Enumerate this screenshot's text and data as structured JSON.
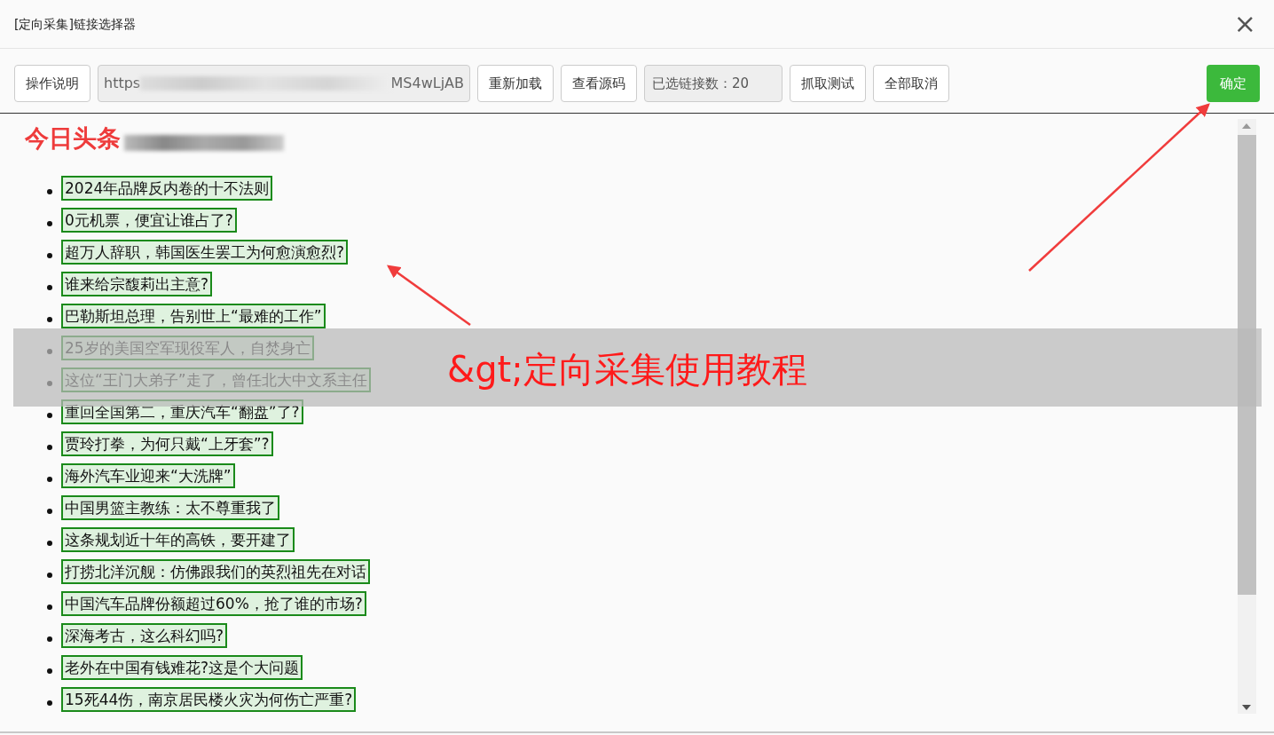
{
  "window": {
    "title": "[定向采集]链接选择器",
    "close": "×"
  },
  "toolbar": [
    {
      "kind": "button",
      "label": "操作说明"
    },
    {
      "kind": "url",
      "start": "https",
      "end": "MS4wLjAB"
    },
    {
      "kind": "button",
      "label": "重新加载"
    },
    {
      "kind": "button",
      "label": "查看源码"
    },
    {
      "kind": "counter",
      "label": "已选链接数：20"
    },
    {
      "kind": "button",
      "label": "抓取测试"
    },
    {
      "kind": "button",
      "label": "全部取消"
    },
    {
      "kind": "primary",
      "label": "确定"
    }
  ],
  "annotation": "今日头条",
  "links": [
    {
      "text": "2024年品牌反内卷的十不法则",
      "selected": true
    },
    {
      "text": "0元机票，便宜让谁占了?",
      "selected": true
    },
    {
      "text": "超万人辞职，韩国医生罢工为何愈演愈烈?",
      "selected": true
    },
    {
      "text": "谁来给宗馥莉出主意?",
      "selected": true
    },
    {
      "text": "巴勒斯坦总理，告别世上“最难的工作”",
      "selected": true
    },
    {
      "text": "25岁的美国空军现役军人，自焚身亡",
      "selected": true
    },
    {
      "text": "这位“王门大弟子”走了，曾任北大中文系主任",
      "selected": true
    },
    {
      "text": "重回全国第二，重庆汽车“翻盘”了?",
      "selected": true
    },
    {
      "text": "贾玲打拳，为何只戴“上牙套”?",
      "selected": true
    },
    {
      "text": "海外汽车业迎来“大洗牌”",
      "selected": true
    },
    {
      "text": "中国男篮主教练：太不尊重我了",
      "selected": true
    },
    {
      "text": "这条规划近十年的高铁，要开建了",
      "selected": true
    },
    {
      "text": "打捞北洋沉舰：仿佛跟我们的英烈祖先在对话",
      "selected": true
    },
    {
      "text": "中国汽车品牌份额超过60%，抢了谁的市场?",
      "selected": true
    },
    {
      "text": "深海考古，这么科幻吗?",
      "selected": true
    },
    {
      "text": "老外在中国有钱难花?这是个大问题",
      "selected": true
    },
    {
      "text": "15死44伤，南京居民楼火灾为何伤亡严重?",
      "selected": true
    }
  ],
  "banner": "&gt;定向采集使用教程"
}
